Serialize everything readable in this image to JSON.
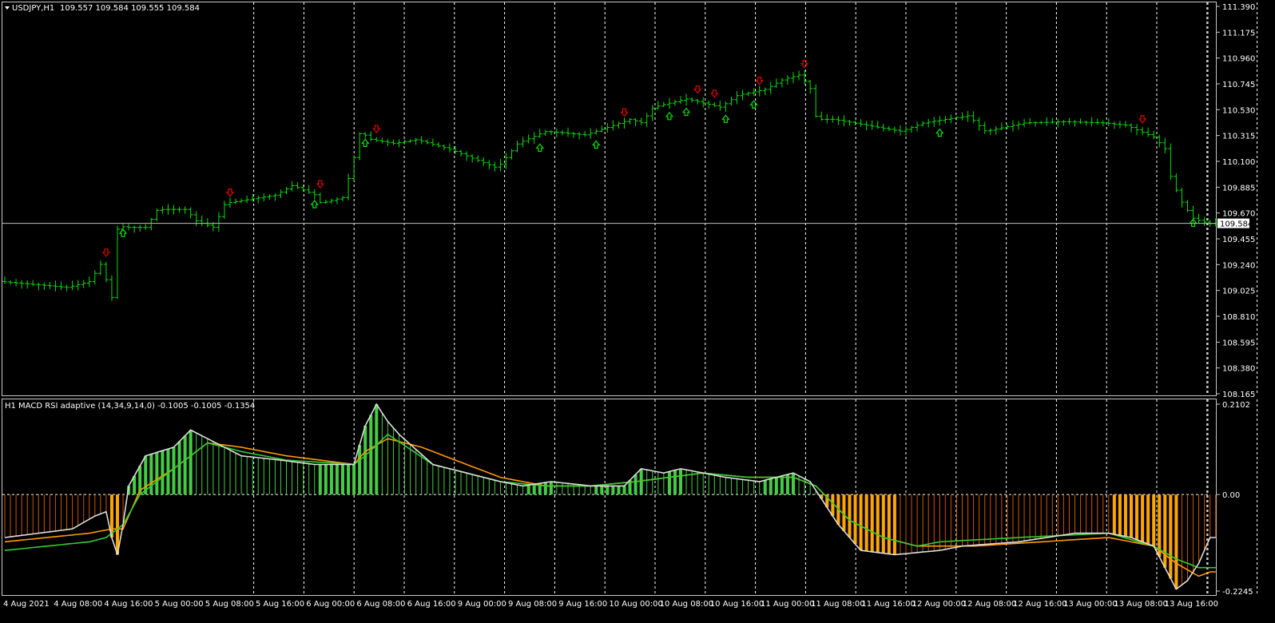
{
  "main_panel": {
    "symbol_label": "USDJPY,H1",
    "ohlc_label": "109.557 109.584 109.555 109.584",
    "current_price_label": "109.584",
    "price_min": 108.165,
    "price_max": 111.39,
    "price_ticks": [
      "111.390",
      "111.175",
      "110.960",
      "110.745",
      "110.530",
      "110.315",
      "110.100",
      "109.885",
      "109.670",
      "109.455",
      "109.240",
      "109.025",
      "108.810",
      "108.595",
      "108.380",
      "108.165"
    ],
    "current_price": 109.584
  },
  "indicator_panel": {
    "title": "H1 MACD RSI adaptive (14,34,9,14,0) -0.1005 -0.1005 -0.1354",
    "value_min": -0.2245,
    "value_max": 0.2102,
    "ticks": [
      "0.2102",
      "0.00",
      "-0.2245"
    ]
  },
  "time_axis": {
    "labels": [
      "4 Aug 2021",
      "4 Aug 08:00",
      "4 Aug 16:00",
      "5 Aug 00:00",
      "5 Aug 08:00",
      "5 Aug 16:00",
      "6 Aug 00:00",
      "6 Aug 08:00",
      "6 Aug 16:00",
      "9 Aug 00:00",
      "9 Aug 08:00",
      "9 Aug 16:00",
      "10 Aug 00:00",
      "10 Aug 08:00",
      "10 Aug 16:00",
      "11 Aug 00:00",
      "11 Aug 08:00",
      "11 Aug 16:00",
      "12 Aug 00:00",
      "12 Aug 08:00",
      "12 Aug 16:00",
      "13 Aug 00:00",
      "13 Aug 08:00",
      "13 Aug 16:00"
    ]
  },
  "chart_data": {
    "type": "line",
    "price_path": [
      [
        0,
        109.1
      ],
      [
        12,
        109.05
      ],
      [
        16,
        109.1
      ],
      [
        18,
        109.25
      ],
      [
        19,
        109.1
      ],
      [
        20,
        108.95
      ],
      [
        21,
        109.6
      ],
      [
        22,
        109.55
      ],
      [
        26,
        109.55
      ],
      [
        28,
        109.7
      ],
      [
        33,
        109.7
      ],
      [
        35,
        109.6
      ],
      [
        38,
        109.55
      ],
      [
        40,
        109.75
      ],
      [
        49,
        109.82
      ],
      [
        52,
        109.9
      ],
      [
        56,
        109.82
      ],
      [
        57,
        109.75
      ],
      [
        61,
        109.8
      ],
      [
        63,
        110.15
      ],
      [
        64,
        110.35
      ],
      [
        66,
        110.28
      ],
      [
        70,
        110.25
      ],
      [
        74,
        110.28
      ],
      [
        80,
        110.2
      ],
      [
        88,
        110.05
      ],
      [
        89,
        110.08
      ],
      [
        92,
        110.25
      ],
      [
        97,
        110.35
      ],
      [
        104,
        110.32
      ],
      [
        109,
        110.4
      ],
      [
        112,
        110.45
      ],
      [
        114,
        110.42
      ],
      [
        116,
        110.55
      ],
      [
        122,
        110.62
      ],
      [
        128,
        110.55
      ],
      [
        131,
        110.65
      ],
      [
        136,
        110.7
      ],
      [
        139,
        110.78
      ],
      [
        142,
        110.82
      ],
      [
        144,
        110.7
      ],
      [
        145,
        110.45
      ],
      [
        148,
        110.45
      ],
      [
        154,
        110.4
      ],
      [
        160,
        110.35
      ],
      [
        164,
        110.42
      ],
      [
        168,
        110.45
      ],
      [
        172,
        110.48
      ],
      [
        175,
        110.35
      ],
      [
        182,
        110.42
      ],
      [
        189,
        110.43
      ],
      [
        196,
        110.42
      ],
      [
        200,
        110.4
      ],
      [
        205,
        110.3
      ],
      [
        207,
        110.2
      ],
      [
        208,
        109.95
      ],
      [
        210,
        109.75
      ],
      [
        212,
        109.62
      ],
      [
        215,
        109.58
      ]
    ],
    "sell_arrow_bars": [
      18,
      40,
      56,
      66,
      110,
      123,
      126,
      134,
      142,
      202
    ],
    "buy_arrow_bars": [
      21,
      55,
      64,
      95,
      105,
      118,
      121,
      128,
      133,
      166,
      211
    ],
    "macd_hist_path": [
      [
        0,
        -0.1
      ],
      [
        12,
        -0.08
      ],
      [
        16,
        -0.05
      ],
      [
        18,
        -0.04
      ],
      [
        19,
        -0.1
      ],
      [
        20,
        -0.14
      ],
      [
        21,
        -0.07
      ],
      [
        22,
        0.02
      ],
      [
        25,
        0.09
      ],
      [
        30,
        0.11
      ],
      [
        33,
        0.15
      ],
      [
        36,
        0.13
      ],
      [
        42,
        0.09
      ],
      [
        49,
        0.08
      ],
      [
        55,
        0.07
      ],
      [
        62,
        0.07
      ],
      [
        64,
        0.16
      ],
      [
        66,
        0.21
      ],
      [
        68,
        0.17
      ],
      [
        70,
        0.14
      ],
      [
        76,
        0.07
      ],
      [
        88,
        0.03
      ],
      [
        92,
        0.02
      ],
      [
        97,
        0.03
      ],
      [
        104,
        0.02
      ],
      [
        110,
        0.02
      ],
      [
        113,
        0.06
      ],
      [
        117,
        0.05
      ],
      [
        120,
        0.06
      ],
      [
        124,
        0.05
      ],
      [
        128,
        0.04
      ],
      [
        134,
        0.03
      ],
      [
        140,
        0.05
      ],
      [
        143,
        0.03
      ],
      [
        148,
        -0.07
      ],
      [
        152,
        -0.13
      ],
      [
        158,
        -0.14
      ],
      [
        166,
        -0.13
      ],
      [
        170,
        -0.12
      ],
      [
        180,
        -0.11
      ],
      [
        190,
        -0.09
      ],
      [
        196,
        -0.09
      ],
      [
        200,
        -0.1
      ],
      [
        204,
        -0.12
      ],
      [
        206,
        -0.17
      ],
      [
        208,
        -0.22
      ],
      [
        210,
        -0.2
      ],
      [
        212,
        -0.16
      ],
      [
        214,
        -0.1
      ]
    ],
    "signal_path": [
      [
        0,
        -0.11
      ],
      [
        15,
        -0.09
      ],
      [
        19,
        -0.08
      ],
      [
        21,
        -0.08
      ],
      [
        24,
        0.01
      ],
      [
        30,
        0.06
      ],
      [
        36,
        0.12
      ],
      [
        42,
        0.11
      ],
      [
        50,
        0.09
      ],
      [
        62,
        0.07
      ],
      [
        64,
        0.1
      ],
      [
        68,
        0.13
      ],
      [
        74,
        0.11
      ],
      [
        88,
        0.04
      ],
      [
        96,
        0.02
      ],
      [
        104,
        0.02
      ],
      [
        112,
        0.03
      ],
      [
        124,
        0.05
      ],
      [
        132,
        0.04
      ],
      [
        140,
        0.04
      ],
      [
        144,
        0.02
      ],
      [
        150,
        -0.06
      ],
      [
        156,
        -0.1
      ],
      [
        162,
        -0.12
      ],
      [
        172,
        -0.12
      ],
      [
        184,
        -0.11
      ],
      [
        196,
        -0.1
      ],
      [
        204,
        -0.12
      ],
      [
        208,
        -0.16
      ],
      [
        212,
        -0.19
      ],
      [
        214,
        -0.18
      ]
    ],
    "rsi_path": [
      [
        0,
        -0.13
      ],
      [
        15,
        -0.11
      ],
      [
        18,
        -0.1
      ],
      [
        21,
        -0.07
      ],
      [
        24,
        0.0
      ],
      [
        30,
        0.06
      ],
      [
        36,
        0.12
      ],
      [
        42,
        0.1
      ],
      [
        50,
        0.08
      ],
      [
        62,
        0.07
      ],
      [
        64,
        0.09
      ],
      [
        68,
        0.14
      ],
      [
        76,
        0.07
      ],
      [
        88,
        0.03
      ],
      [
        96,
        0.02
      ],
      [
        104,
        0.02
      ],
      [
        112,
        0.03
      ],
      [
        124,
        0.05
      ],
      [
        132,
        0.04
      ],
      [
        140,
        0.04
      ],
      [
        144,
        0.02
      ],
      [
        150,
        -0.06
      ],
      [
        156,
        -0.1
      ],
      [
        162,
        -0.12
      ],
      [
        166,
        -0.11
      ],
      [
        180,
        -0.1
      ],
      [
        196,
        -0.09
      ],
      [
        204,
        -0.12
      ],
      [
        208,
        -0.15
      ],
      [
        212,
        -0.17
      ],
      [
        214,
        -0.17
      ]
    ]
  }
}
